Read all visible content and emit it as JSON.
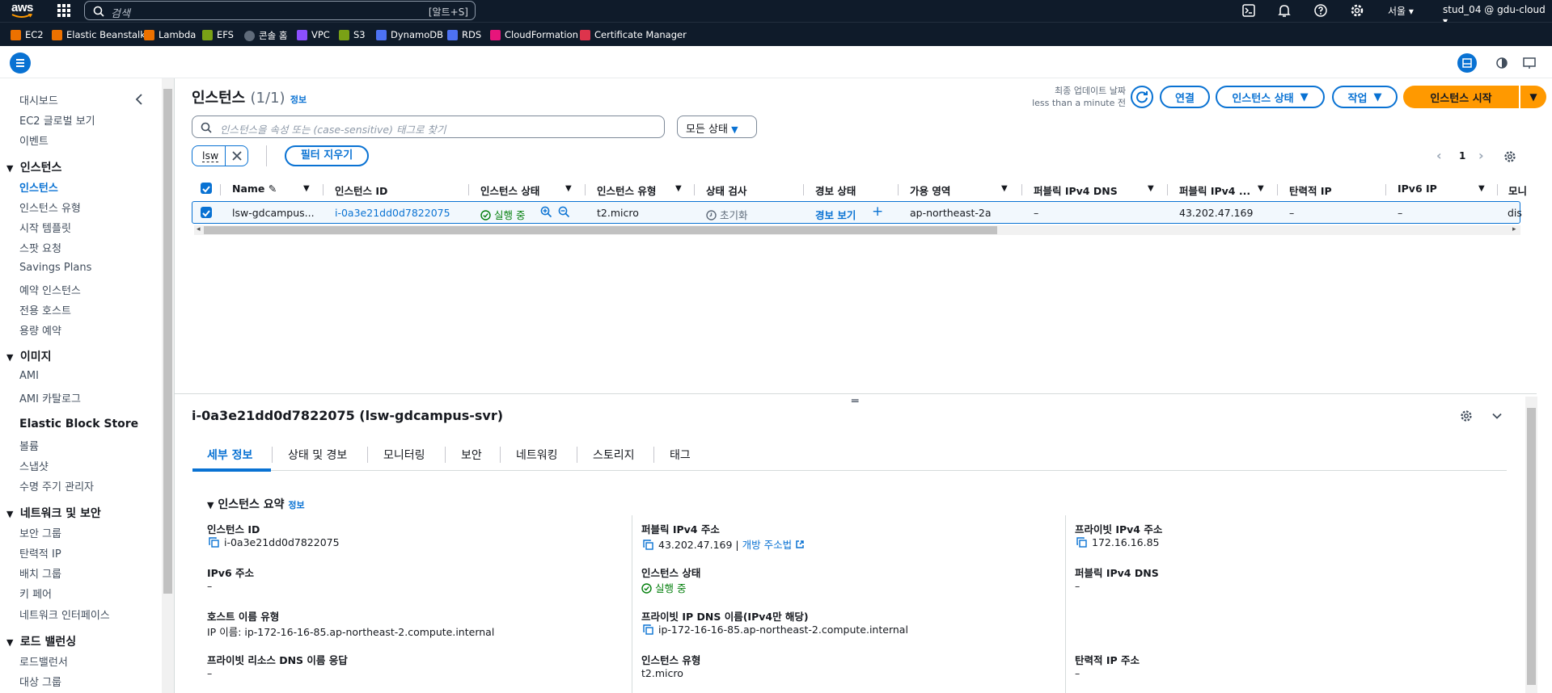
{
  "topbar": {
    "logo_text": "aws",
    "search_placeholder": "검색",
    "search_shortcut": "[알트+S]",
    "region": "서울 ▾",
    "user": "stud_04 @ gdu-cloud ▾"
  },
  "favorites": [
    {
      "label": "EC2",
      "color": "#ed7100"
    },
    {
      "label": "Elastic Beanstalk",
      "color": "#ed7100"
    },
    {
      "label": "Lambda",
      "color": "#ed7100"
    },
    {
      "label": "EFS",
      "color": "#7aa116"
    },
    {
      "label": "콘솔 홈",
      "color": "#5f6b7a"
    },
    {
      "label": "VPC",
      "color": "#8c4fff"
    },
    {
      "label": "S3",
      "color": "#7aa116"
    },
    {
      "label": "DynamoDB",
      "color": "#4d72f3"
    },
    {
      "label": "RDS",
      "color": "#4d72f3"
    },
    {
      "label": "CloudFormation",
      "color": "#e7157b"
    },
    {
      "label": "Certificate Manager",
      "color": "#dd344c"
    }
  ],
  "sidebar": {
    "top_items": [
      "대시보드",
      "EC2 글로벌 보기",
      "이벤트"
    ],
    "sections": [
      {
        "title": "인스턴스",
        "items": [
          "인스턴스",
          "인스턴스 유형",
          "시작 템플릿",
          "스팟 요청",
          "Savings Plans",
          "예약 인스턴스",
          "전용 호스트",
          "용량 예약"
        ]
      },
      {
        "title": "이미지",
        "items": [
          "AMI",
          "AMI 카탈로그"
        ]
      },
      {
        "title": "Elastic Block Store",
        "items": [
          "볼륨",
          "스냅샷",
          "수명 주기 관리자"
        ]
      },
      {
        "title": "네트워크 및 보안",
        "items": [
          "보안 그룹",
          "탄력적 IP",
          "배치 그룹",
          "키 페어",
          "네트워크 인터페이스"
        ]
      },
      {
        "title": "로드 밸런싱",
        "items": [
          "로드밸런서",
          "대상 그룹"
        ]
      }
    ]
  },
  "header": {
    "title": "인스턴스",
    "count": "(1/1)",
    "info": "정보",
    "last_updated_label": "최종 업데이트 날짜",
    "last_updated_value": "less than a minute 전",
    "connect": "연결",
    "instance_state": "인스턴스 상태",
    "actions": "작업",
    "launch": "인스턴스 시작"
  },
  "filter": {
    "placeholder": "인스턴스을 속성 또는 (case-sensitive) 태그로 찾기",
    "state_select": "모든 상태",
    "token": "lsw",
    "clear": "필터 지우기",
    "page": "1"
  },
  "table": {
    "columns": [
      "Name",
      "인스턴스 ID",
      "인스턴스 상태",
      "인스턴스 유형",
      "상태 검사",
      "경보 상태",
      "가용 영역",
      "퍼블릭 IPv4 DNS",
      "퍼블릭 IPv4 ...",
      "탄력적 IP",
      "IPv6 IP",
      "모니"
    ],
    "row": {
      "name": "lsw-gdcampus...",
      "id": "i-0a3e21dd0d7822075",
      "state": "실행 중",
      "type": "t2.micro",
      "check": "초기화",
      "alarm": "경보 보기",
      "az": "ap-northeast-2a",
      "dns": "–",
      "ipv4": "43.202.47.169",
      "eip": "–",
      "ipv6": "–",
      "mon": "dis"
    }
  },
  "detail": {
    "title": "i-0a3e21dd0d7822075 (lsw-gdcampus-svr)",
    "tabs": [
      "세부 정보",
      "상태 및 경보",
      "모니터링",
      "보안",
      "네트워킹",
      "스토리지",
      "태그"
    ],
    "summary_title": "인스턴스 요약",
    "summary_info": "정보",
    "fields": {
      "instance_id_label": "인스턴스 ID",
      "instance_id": "i-0a3e21dd0d7822075",
      "public_ipv4_label": "퍼블릭 IPv4 주소",
      "public_ipv4": "43.202.47.169",
      "open_address": "개방 주소법",
      "private_ipv4_label": "프라이빗 IPv4 주소",
      "private_ipv4": "172.16.16.85",
      "ipv6_label": "IPv6 주소",
      "ipv6": "–",
      "state_label": "인스턴스 상태",
      "state": "실행 중",
      "public_dns_label": "퍼블릭 IPv4 DNS",
      "public_dns": "–",
      "hostname_type_label": "호스트 이름 유형",
      "hostname_type": "IP 이름: ip-172-16-16-85.ap-northeast-2.compute.internal",
      "private_dns_label": "프라이빗 IP DNS 이름(IPv4만 해당)",
      "private_dns": "ip-172-16-16-85.ap-northeast-2.compute.internal",
      "resource_dns_label": "프라이빗 리소스 DNS 이름 응답",
      "resource_dns": "–",
      "type_label": "인스턴스 유형",
      "type": "t2.micro",
      "eip_label": "탄력적 IP 주소",
      "eip": "–"
    }
  }
}
